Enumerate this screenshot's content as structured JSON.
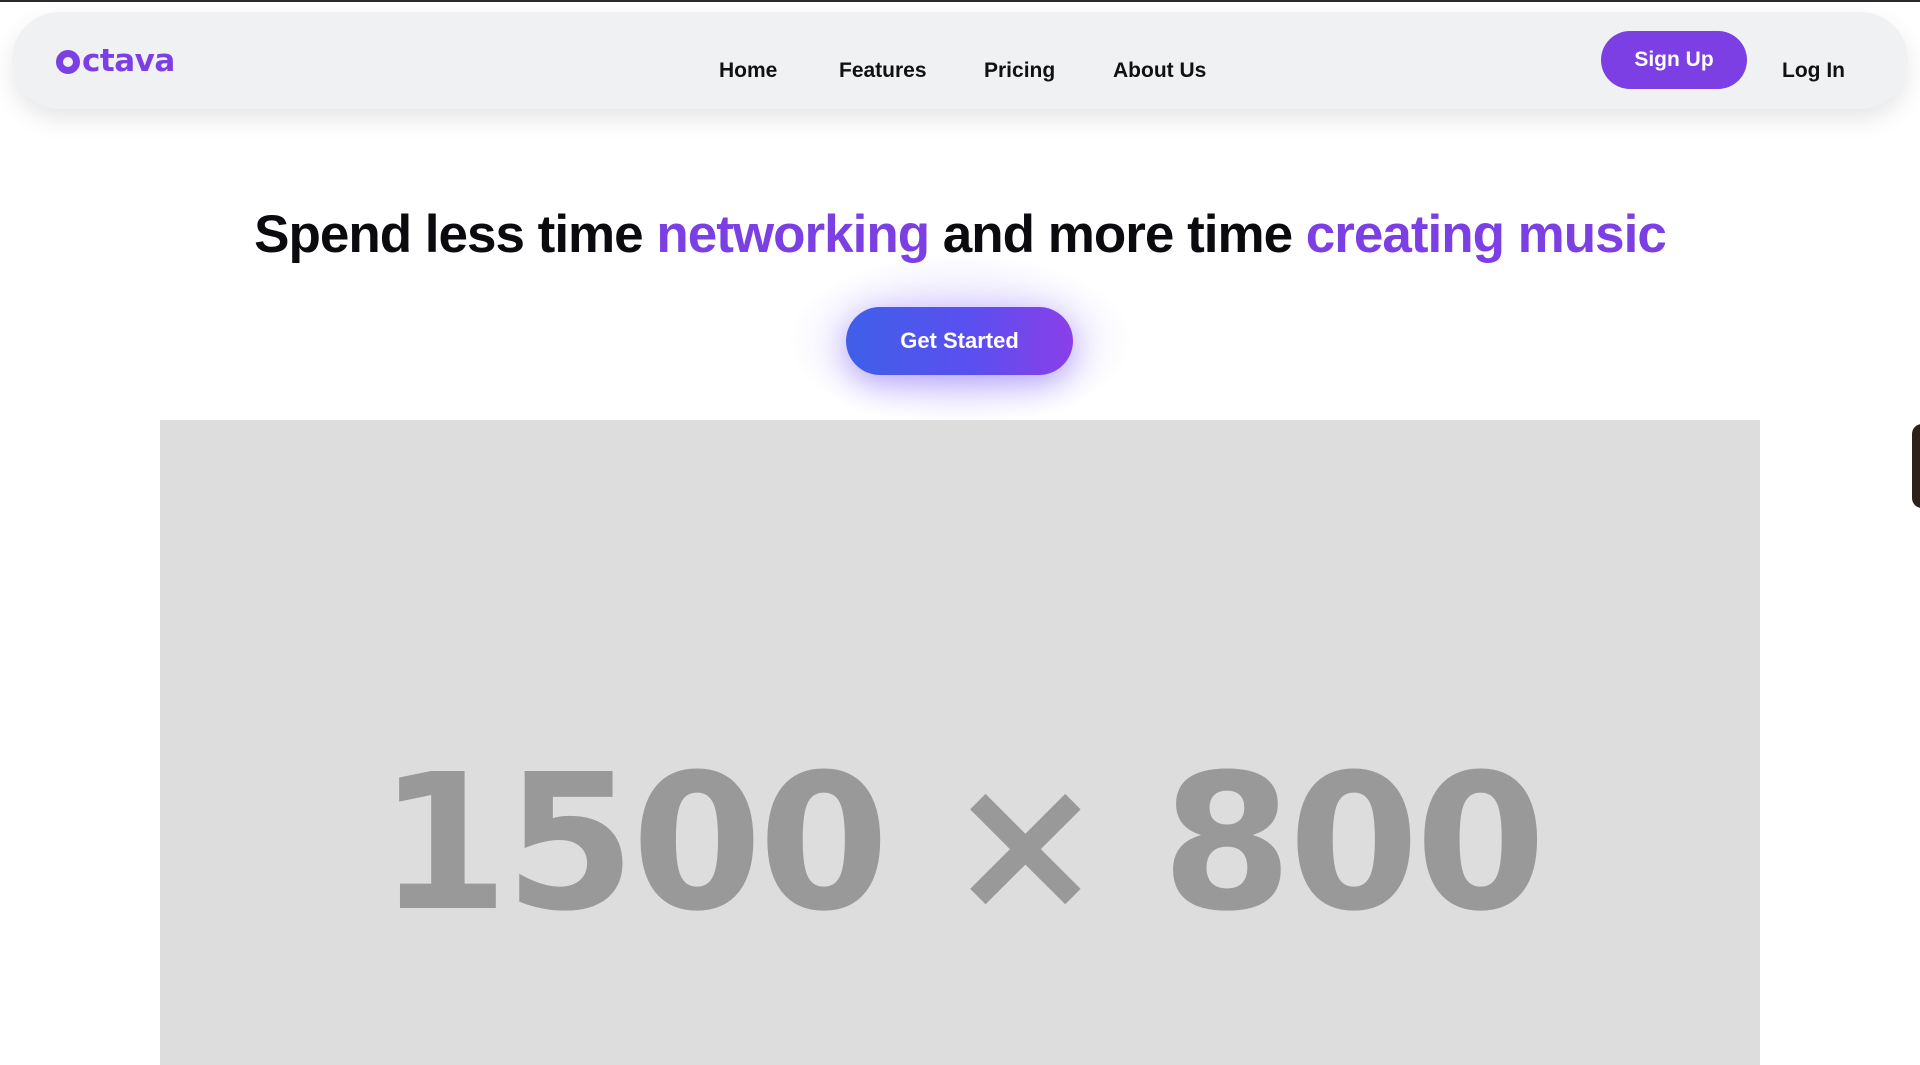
{
  "brand": {
    "logo_text": "ctava",
    "logo_icon": "ring-o-icon",
    "accent_color": "#7b3fe4"
  },
  "nav": {
    "items": [
      {
        "label": "Home"
      },
      {
        "label": "Features"
      },
      {
        "label": "Pricing"
      },
      {
        "label": "About Us"
      }
    ],
    "signup_label": "Sign Up",
    "login_label": "Log In"
  },
  "hero": {
    "title_part1": "Spend less time ",
    "title_highlight1": "networking",
    "title_part2": " and more time ",
    "title_highlight2": "creating music",
    "cta_label": "Get Started",
    "cta_gradient": [
      "#3f5fe8",
      "#8a3fe8"
    ]
  },
  "media": {
    "placeholder_text": "1500 × 800",
    "placeholder_bg": "#dddddd",
    "placeholder_fg": "#999999"
  }
}
